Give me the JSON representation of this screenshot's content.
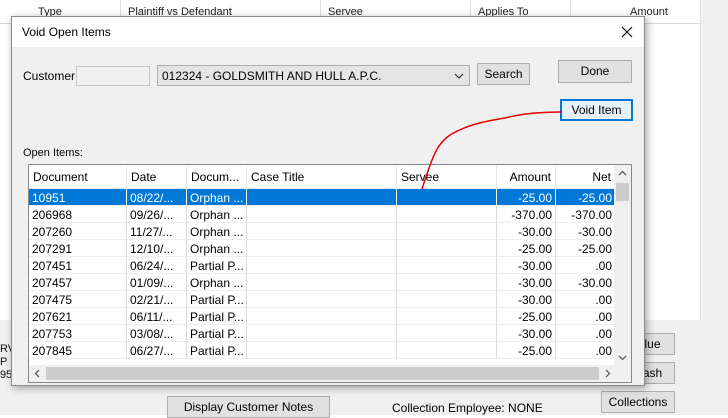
{
  "background": {
    "columns": [
      "Type",
      "Plaintiff vs Defendant",
      "Servee",
      "Applies To",
      "Amount"
    ],
    "left_fragments": [
      "RV",
      "P",
      "95"
    ],
    "buttons": {
      "due": "lue",
      "cash": "ash",
      "collections": "Collections",
      "display_notes": "Display Customer Notes"
    },
    "collection_employee": "Collection Employee: NONE"
  },
  "dialog": {
    "title": "Void Open Items",
    "customer_label": "Customer:",
    "customer_code": "",
    "customer_selected": "012324 - GOLDSMITH AND HULL A.P.C.",
    "search_label": "Search",
    "done_label": "Done",
    "void_item_label": "Void Item",
    "open_items_label": "Open Items:"
  },
  "grid": {
    "headers": [
      "Document",
      "Date",
      "Docum...",
      "Case Title",
      "Servee",
      "Amount",
      "Net"
    ],
    "rows": [
      {
        "doc": "10951",
        "date": "08/22/...",
        "type": "Orphan ...",
        "case": "",
        "servee": "",
        "amount": "-25.00",
        "net": "-25.00",
        "selected": true
      },
      {
        "doc": "206968",
        "date": "09/26/...",
        "type": "Orphan ...",
        "case": "",
        "servee": "",
        "amount": "-370.00",
        "net": "-370.00"
      },
      {
        "doc": "207260",
        "date": "11/27/...",
        "type": "Orphan ...",
        "case": "",
        "servee": "",
        "amount": "-30.00",
        "net": "-30.00"
      },
      {
        "doc": "207291",
        "date": "12/10/...",
        "type": "Orphan ...",
        "case": "",
        "servee": "",
        "amount": "-25.00",
        "net": "-25.00"
      },
      {
        "doc": "207451",
        "date": "06/24/...",
        "type": "Partial P...",
        "case": "",
        "servee": "",
        "amount": "-30.00",
        "net": ".00"
      },
      {
        "doc": "207457",
        "date": "01/09/...",
        "type": "Orphan ...",
        "case": "",
        "servee": "",
        "amount": "-30.00",
        "net": "-30.00"
      },
      {
        "doc": "207475",
        "date": "02/21/...",
        "type": "Partial P...",
        "case": "",
        "servee": "",
        "amount": "-30.00",
        "net": ".00"
      },
      {
        "doc": "207621",
        "date": "06/11/...",
        "type": "Partial P...",
        "case": "",
        "servee": "",
        "amount": "-25.00",
        "net": ".00"
      },
      {
        "doc": "207753",
        "date": "03/08/...",
        "type": "Partial P...",
        "case": "",
        "servee": "",
        "amount": "-30.00",
        "net": ".00"
      },
      {
        "doc": "207845",
        "date": "06/27/...",
        "type": "Partial P...",
        "case": "",
        "servee": "",
        "amount": "-25.00",
        "net": ".00"
      }
    ]
  },
  "colors": {
    "selection": "#0078d7",
    "annotation": "#e00000",
    "dialog_bg": "#f0f0f0"
  },
  "icons": [
    "close-icon",
    "chevron-down-icon",
    "scroll-up-icon",
    "scroll-down-icon",
    "scroll-left-icon",
    "scroll-right-icon"
  ]
}
